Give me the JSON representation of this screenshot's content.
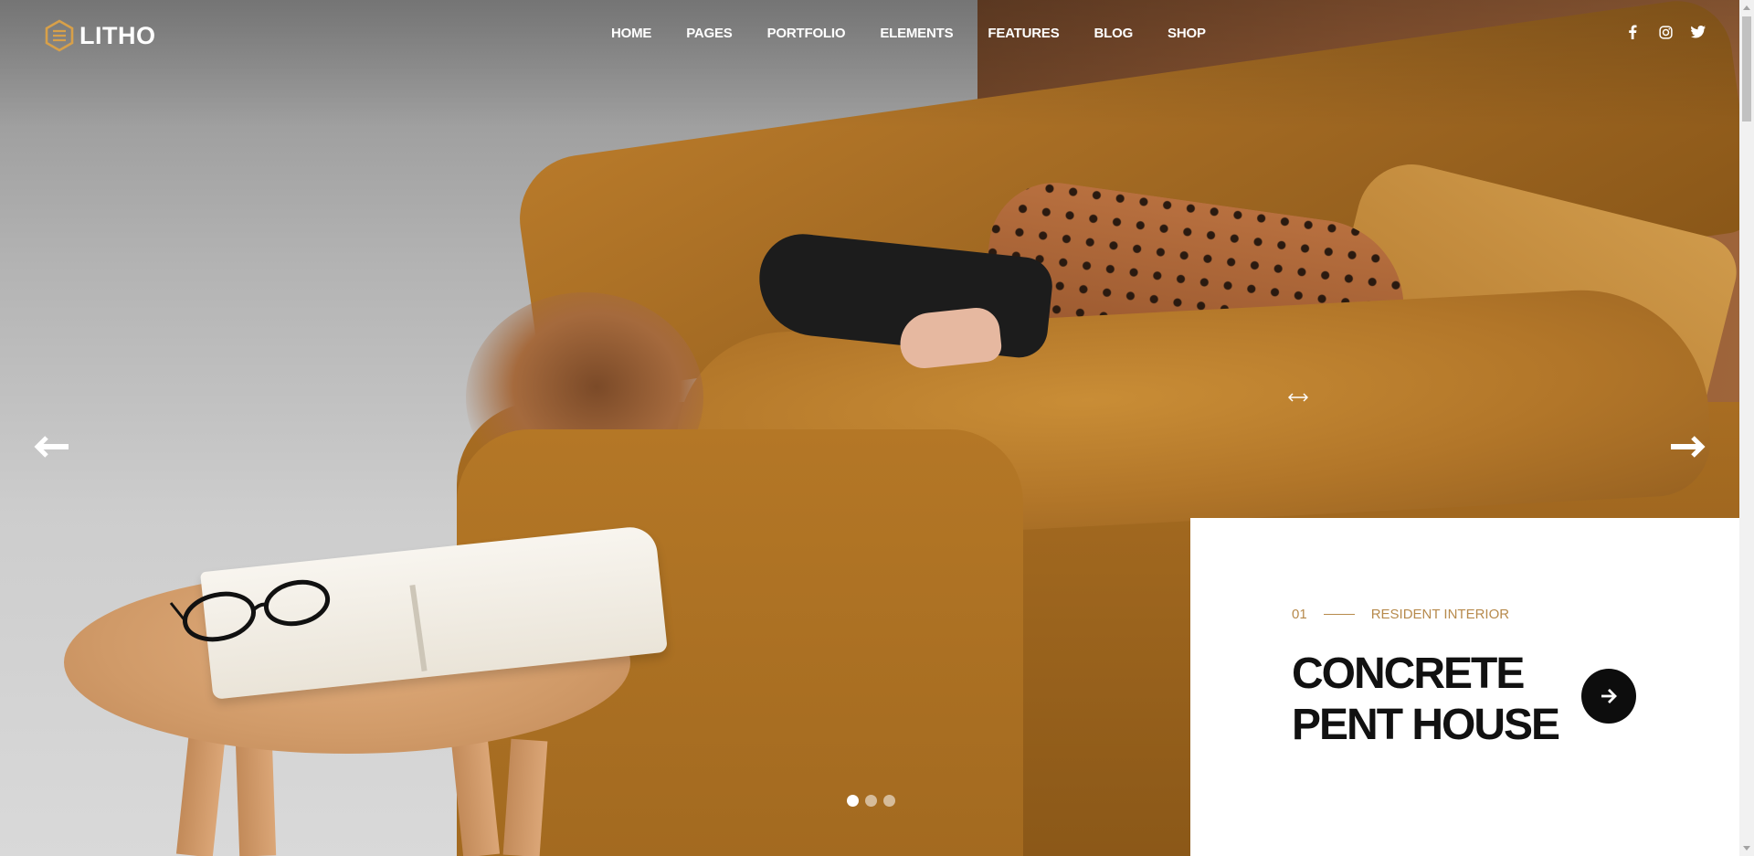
{
  "brand": {
    "name": "LITHO",
    "accent_color": "#d8a049"
  },
  "nav": {
    "items": [
      {
        "label": "HOME"
      },
      {
        "label": "PAGES"
      },
      {
        "label": "PORTFOLIO"
      },
      {
        "label": "ELEMENTS"
      },
      {
        "label": "FEATURES"
      },
      {
        "label": "BLOG"
      },
      {
        "label": "SHOP"
      }
    ]
  },
  "social": {
    "icons": [
      "facebook-icon",
      "instagram-icon",
      "twitter-icon"
    ]
  },
  "slider": {
    "current_index": 1,
    "total_slides": 3,
    "prev_icon": "arrow-left-icon",
    "next_icon": "arrow-right-icon"
  },
  "card": {
    "number": "01",
    "category": "RESIDENT INTERIOR",
    "title": "CONCRETE PENT HOUSE",
    "meta_color": "#b78a4c",
    "button_icon": "arrow-right-icon"
  }
}
